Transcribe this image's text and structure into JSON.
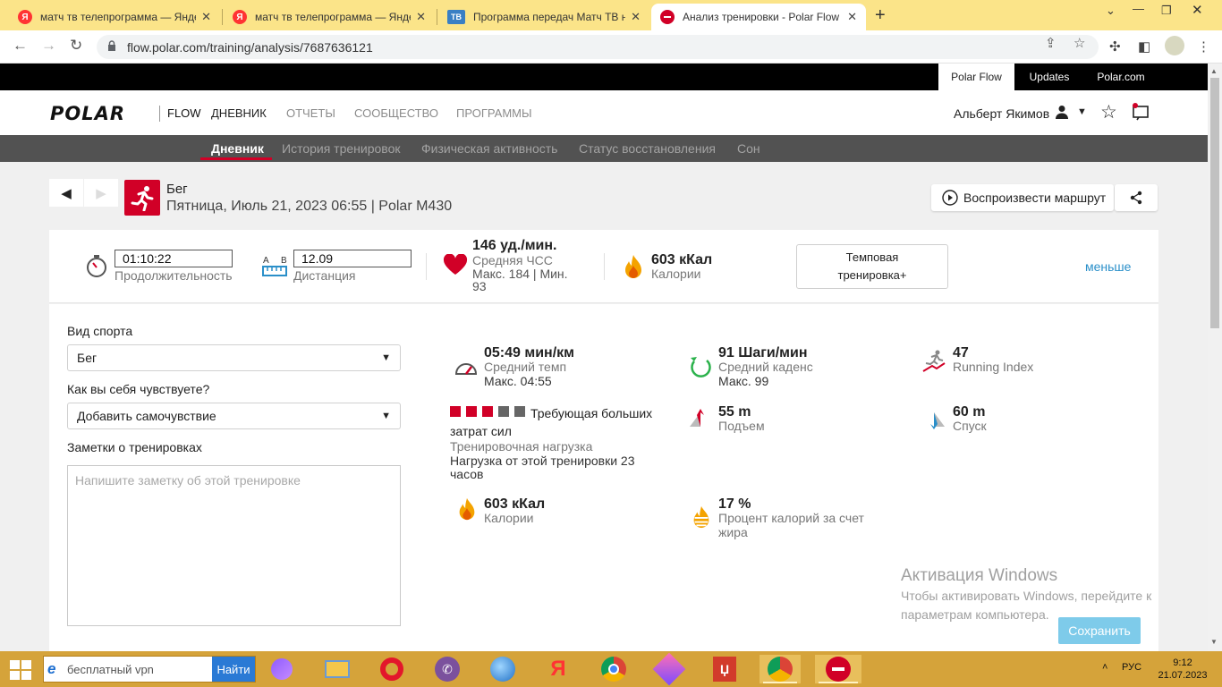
{
  "browser": {
    "tabs": [
      {
        "title": "матч тв телепрограмма — Яндекс",
        "close": "✕"
      },
      {
        "title": "матч тв телепрограмма — Яндекс",
        "close": "✕"
      },
      {
        "title": "Программа передач Матч ТВ на",
        "close": "✕",
        "badge": "ТВ"
      },
      {
        "title": "Анализ тренировки - Polar Flow",
        "close": "✕"
      }
    ],
    "url": "flow.polar.com/training/analysis/7687636121"
  },
  "topbar": {
    "links": [
      "Polar Flow",
      "Updates",
      "Polar.com"
    ]
  },
  "header": {
    "logo": "POLAR",
    "flow": "FLOW",
    "nav": [
      "ДНЕВНИК",
      "ОТЧЕТЫ",
      "СООБЩЕСТВО",
      "ПРОГРАММЫ"
    ],
    "user": "Альберт Якимов"
  },
  "subnav": [
    "Дневник",
    "История тренировок",
    "Физическая активность",
    "Статус восстановления",
    "Сон"
  ],
  "training": {
    "sport": "Бег",
    "date_line": "Пятница, Июль 21, 2023 06:55 | Polar M430",
    "play_route": "Воспроизвести маршрут"
  },
  "summary": {
    "duration": {
      "value": "01:10:22",
      "label": "Продолжительность"
    },
    "distance": {
      "value": "12.09",
      "label": "Дистанция",
      "ab": [
        "A",
        "B"
      ]
    },
    "hr": {
      "value": "146 уд./мин.",
      "label": "Средняя ЧСС",
      "maxmin": "Макс. 184  |  Мин.",
      "min": "93"
    },
    "calories": {
      "value": "603 кКал",
      "label": "Калории"
    },
    "type_button": "Темповая тренировка+",
    "less": "меньше"
  },
  "form": {
    "sport_label": "Вид спорта",
    "sport_value": "Бег",
    "feel_label": "Как вы себя чувствуете?",
    "feel_value": "Добавить самочувствие",
    "notes_label": "Заметки о тренировках",
    "notes_placeholder": "Напишите заметку об этой тренировке"
  },
  "metrics": {
    "pace": {
      "value": "05:49 мин/км",
      "label": "Средний темп",
      "sub": "Макс. 04:55"
    },
    "cadence": {
      "value": "91 Шаги/мин",
      "label": "Средний каденс",
      "sub": "Макс. 99"
    },
    "running_index": {
      "value": "47",
      "label": "Running Index"
    },
    "load": {
      "title": "Требующая больших затрат сил",
      "label": "Тренировочная нагрузка",
      "sub": "Нагрузка от этой тренировки 23 часов",
      "filled": 3,
      "total": 5
    },
    "ascent": {
      "value": "55 m",
      "label": "Подъем"
    },
    "descent": {
      "value": "60 m",
      "label": "Спуск"
    },
    "calories": {
      "value": "603 кКал",
      "label": "Калории"
    },
    "fat": {
      "value": "17 %",
      "label": "Процент калорий за счет жира"
    }
  },
  "watermark": {
    "title": "Активация Windows",
    "line1": "Чтобы активировать Windows, перейдите к",
    "line2": "параметрам компьютера."
  },
  "save": "Сохранить",
  "taskbar": {
    "search": "бесплатный vpn",
    "search_button": "Найти",
    "lang": "РУС",
    "time": "9:12",
    "date": "21.07.2023"
  },
  "colors": {
    "brand_red": "#d10027",
    "link_blue": "#2a8fc9",
    "save_blue": "#7ecbea"
  }
}
